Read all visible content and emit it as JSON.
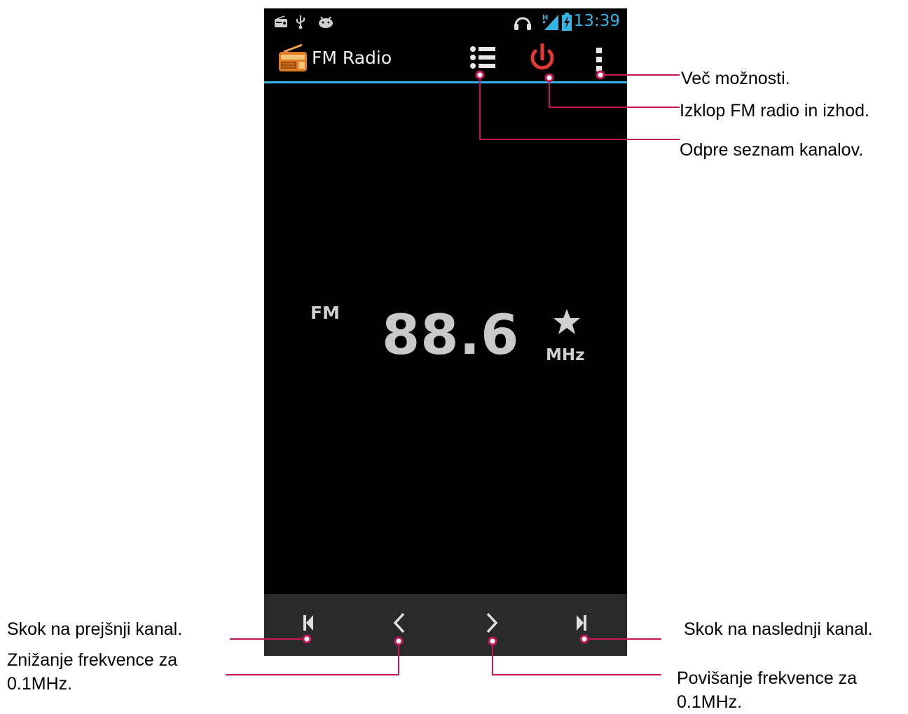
{
  "status_bar": {
    "time": "13:39",
    "icons": [
      "radio-notification-icon",
      "usb-icon",
      "android-debug-icon",
      "headset-icon",
      "hspa-signal-icon",
      "battery-charging-icon"
    ],
    "network_label": "H"
  },
  "action_bar": {
    "app_icon": "radio-icon",
    "title": "FM Radio",
    "actions": [
      "channel-list-icon",
      "power-icon",
      "overflow-menu-icon"
    ],
    "accent_color": "#33b5e5",
    "power_color": "#e53935"
  },
  "tuner": {
    "band": "FM",
    "frequency": "88.6",
    "unit": "MHz",
    "favorite_icon": "star-icon"
  },
  "bottom_controls": [
    "skip-previous-icon",
    "chevron-left-icon",
    "chevron-right-icon",
    "skip-next-icon"
  ],
  "annotations": {
    "more_options": "Več možnosti.",
    "power_off": "Izklop  FM radio in izhod.",
    "channel_list": "Odpre seznam kanalov.",
    "prev_channel": "Skok na prejšnji kanal.",
    "freq_down": "Znižanje frekvence za 0.1MHz.",
    "next_channel": "Skok na naslednji kanal.",
    "freq_up": "Povišanje frekvence za 0.1MHz."
  },
  "callout_color": "#c2185b"
}
